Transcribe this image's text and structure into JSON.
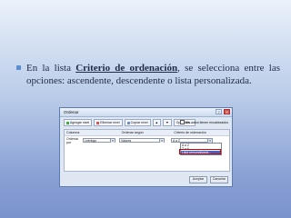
{
  "slide": {
    "bullet_intro": "En la lista ",
    "bullet_term": "Criterio de ordenación",
    "bullet_rest": ", se selecciona entre las opciones: ascendente, descendente o lista personalizada."
  },
  "dialog": {
    "title": "Ordenar",
    "help": "?",
    "close": "✕",
    "toolbar": {
      "add_level": "Agregar nivel",
      "delete_level": "Eliminar nivel",
      "copy_level": "Copiar nivel",
      "options": "Opciones...",
      "headers_check": "Mis datos tienen encabezados"
    },
    "headers": {
      "column": "Columna",
      "sort_on": "Ordenar según",
      "order": "Criterio de ordenación"
    },
    "row": {
      "label": "Ordenar por",
      "column_value": "Leerlogo",
      "sort_on_value": "Valores",
      "order_value": "A a Z"
    },
    "order_options": [
      "A a Z",
      "Z a A",
      "Lista personalizada..."
    ],
    "ok": "Aceptar",
    "cancel": "Cancelar"
  },
  "colors": {
    "accent": "#3a66c4",
    "bullet": "#5b8fd0"
  }
}
